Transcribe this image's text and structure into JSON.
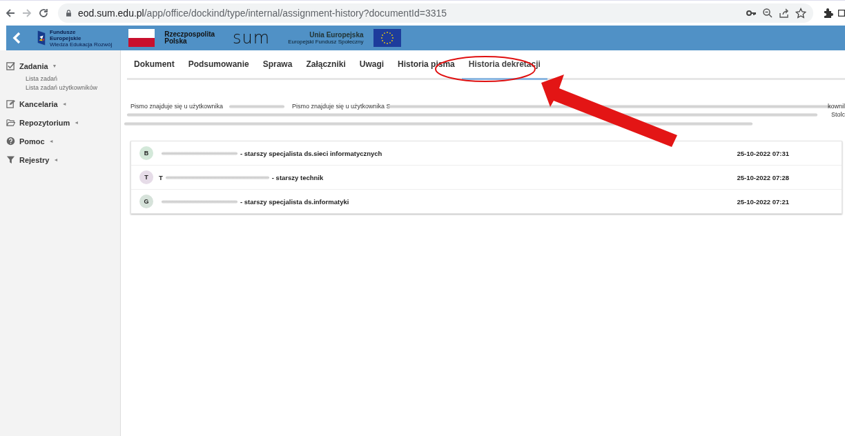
{
  "browser": {
    "url_host": "eod.sum.edu.pl",
    "url_path": "/app/office/dockind/type/internal/assignment-history?documentId=3315"
  },
  "header": {
    "fe_title": "Fundusze\nEuropejskie",
    "fe_sub": "Wiedza Edukacja Rozwój",
    "rp": "Rzeczpospolita\nPolska",
    "sum": "sum",
    "ue_title": "Unia Europejska",
    "ue_sub": "Europejski Fundusz Społeczny"
  },
  "sidebar": {
    "items": [
      {
        "kind": "check",
        "label": "Zadania",
        "caret": "▼",
        "children": [
          {
            "label": "Lista zadań"
          },
          {
            "label": "Lista zadań użytkowników"
          }
        ]
      },
      {
        "kind": "pencil",
        "label": "Kancelaria",
        "caret": "◄"
      },
      {
        "kind": "folder",
        "label": "Repozytorium",
        "caret": "◄"
      },
      {
        "kind": "help",
        "label": "Pomoc",
        "caret": "◄"
      },
      {
        "kind": "filter",
        "label": "Rejestry",
        "caret": "◄"
      }
    ]
  },
  "tabs": [
    {
      "label": "Dokument",
      "selected": false
    },
    {
      "label": "Podsumowanie",
      "selected": false
    },
    {
      "label": "Sprawa",
      "selected": false
    },
    {
      "label": "Załączniki",
      "selected": false
    },
    {
      "label": "Uwagi",
      "selected": false
    },
    {
      "label": "Historia pisma",
      "selected": false
    },
    {
      "label": "Historia dekretacji",
      "selected": true
    }
  ],
  "location": {
    "text_1": "Pismo znajduje się u użytkownika",
    "text_2": "Pismo znajduje się u użytkownika S",
    "text_3": "kownil",
    "text_4": "Stolc"
  },
  "history": [
    {
      "initial": "B",
      "color": "#d3e8d9",
      "role": "- starszy specjalista ds.sieci informatycznych",
      "date": "25-10-2022 07:31"
    },
    {
      "initial": "T",
      "color": "#e6dce8",
      "prefix": "T",
      "role": "- starszy technik",
      "date": "25-10-2022 07:28"
    },
    {
      "initial": "G",
      "color": "#d6e2da",
      "role": "- starszy specjalista ds.informatyki",
      "date": "25-10-2022 07:21"
    }
  ]
}
